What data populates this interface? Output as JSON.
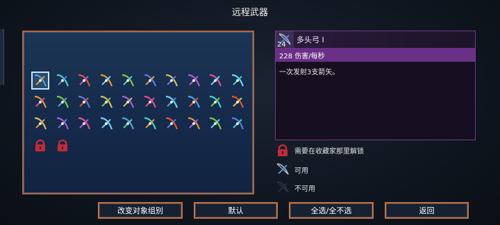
{
  "screen": {
    "title": "远程武器"
  },
  "detail": {
    "count": "24",
    "name": "多头弓 I",
    "stat": "228 伤害/每秒",
    "description": "一次发射3支箭矢。"
  },
  "legend": {
    "locked": "需要在收藏家那里解锁",
    "available": "可用",
    "unavailable": "不可用"
  },
  "buttons": {
    "change_group": "改变对象组别",
    "default": "默认",
    "toggle_all": "全选/全不选",
    "back": "返回"
  },
  "inventory": {
    "rows": [
      [
        "multi-bow",
        "ice-bow",
        "fire-bow",
        "quick-bow",
        "sonic-bow",
        "cross-bow",
        "heavy-crossbow",
        "alpha-crossbow",
        "marksman-bow",
        "war-bow"
      ],
      [
        "boomerang",
        "pickaxe",
        "throwing-axe",
        "spear",
        "electric-whip",
        "frost-blast",
        "dart",
        "grappling-hook",
        "fire-ring",
        "magic-missile"
      ],
      [
        "fireball",
        "ice-crystal",
        "explosive",
        "ice-shard",
        "lightning",
        "poison-dart",
        "bone-spear",
        "whip",
        "scroll",
        "trap"
      ],
      [
        "locked",
        "locked"
      ]
    ]
  },
  "colors": {
    "panel_border": "#b5643a",
    "detail_border": "#6e3f86",
    "stat_bar": "#6a2f86",
    "button_border": "#c9703d",
    "locked": "#d1333f"
  }
}
